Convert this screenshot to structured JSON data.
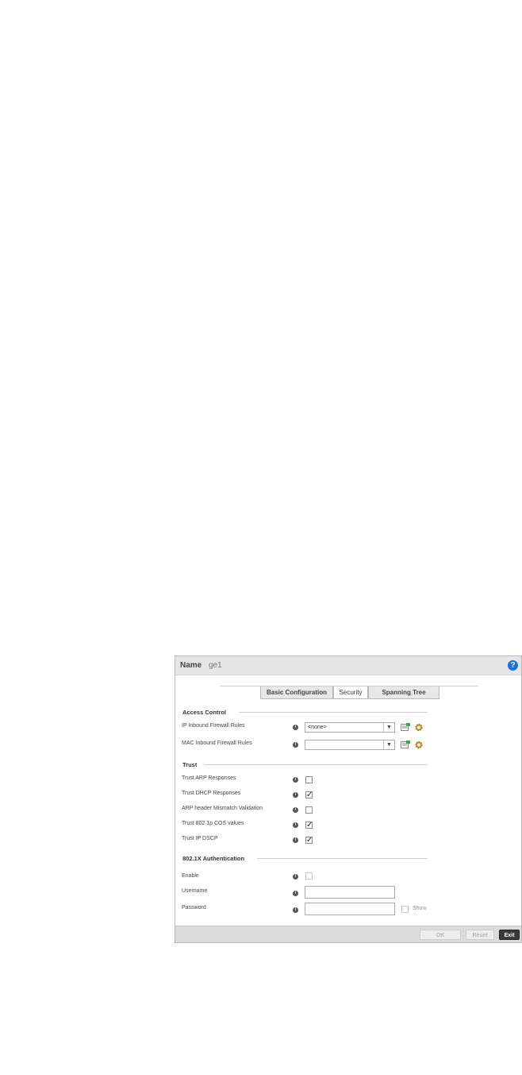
{
  "dialog": {
    "name_label": "Name",
    "name_value": "ge1",
    "help_icon": "?"
  },
  "tabs": [
    {
      "label": "Basic Configuration",
      "active": false
    },
    {
      "label": "Security",
      "active": true
    },
    {
      "label": "Spanning Tree",
      "active": false
    }
  ],
  "access_control": {
    "title": "Access Control",
    "ip_inbound": {
      "label": "IP Inbound Firewall Rules",
      "value": "<none>"
    },
    "mac_inbound": {
      "label": "MAC Inbound Firewall Rules",
      "value": ""
    }
  },
  "trust": {
    "title": "Trust",
    "items": [
      {
        "label": "Trust ARP Responses",
        "checked": false
      },
      {
        "label": "Trust DHCP Responses",
        "checked": true
      },
      {
        "label": "ARP header Mismatch Validation",
        "checked": false
      },
      {
        "label": "Trust 802.1p COS values",
        "checked": true
      },
      {
        "label": "Trust IP DSCP",
        "checked": true
      }
    ]
  },
  "auth": {
    "title": "802.1X Authentication",
    "enable_label": "Enable",
    "username_label": "Username",
    "username_value": "",
    "password_label": "Password",
    "password_value": "",
    "show_label": "Show"
  },
  "footer": {
    "ok": "OK",
    "reset": "Reset",
    "exit": "Exit"
  },
  "icons": {
    "info": "info-icon",
    "check": "✓",
    "dropdown": "▼"
  },
  "colors": {
    "help_blue": "#1a73d9",
    "exit_button": "#3a3a3a"
  }
}
